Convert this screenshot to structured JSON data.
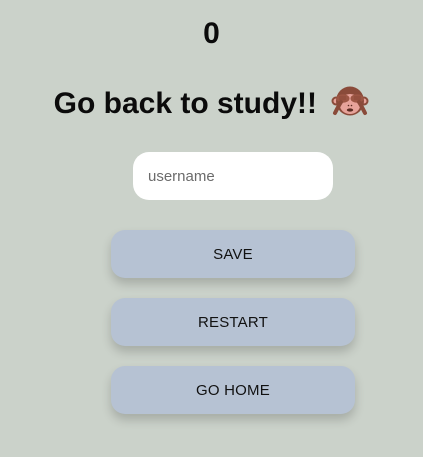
{
  "score": "0",
  "headline": {
    "text": "Go back to study!!",
    "emoji_icon": "see-no-evil-monkey-icon"
  },
  "username_input": {
    "placeholder": "username",
    "value": ""
  },
  "buttons": {
    "save": "SAVE",
    "restart": "RESTART",
    "go_home": "GO HOME"
  },
  "colors": {
    "background": "#cbd2ca",
    "button": "#b6c2d3",
    "input": "#ffffff",
    "text": "#0b0b0b"
  }
}
